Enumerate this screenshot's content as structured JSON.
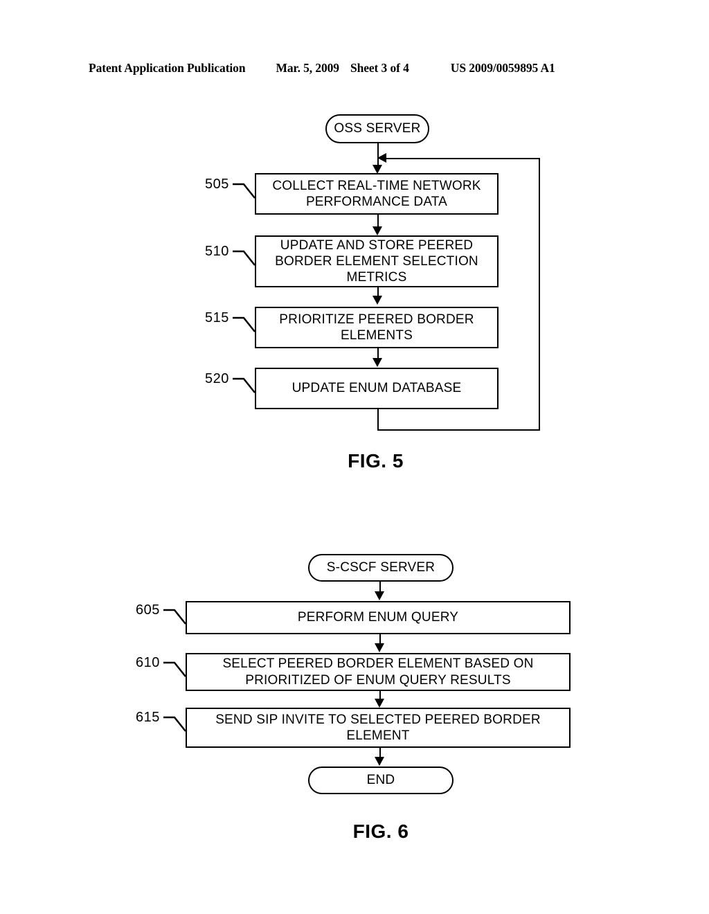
{
  "header": {
    "publication": "Patent Application Publication",
    "date": "Mar. 5, 2009",
    "sheet": "Sheet 3 of 4",
    "patent_number": "US 2009/0059895 A1"
  },
  "figures": [
    {
      "caption": "FIG. 5",
      "terminal_start": "OSS SERVER",
      "steps": [
        {
          "ref": "505",
          "label": "COLLECT REAL-TIME NETWORK PERFORMANCE DATA"
        },
        {
          "ref": "510",
          "label": "UPDATE AND STORE PEERED BORDER ELEMENT SELECTION METRICS"
        },
        {
          "ref": "515",
          "label": "PRIORITIZE PEERED BORDER ELEMENTS"
        },
        {
          "ref": "520",
          "label": "UPDATE ENUM DATABASE"
        }
      ],
      "has_feedback_loop": true
    },
    {
      "caption": "FIG. 6",
      "terminal_start": "S-CSCF SERVER",
      "steps": [
        {
          "ref": "605",
          "label": "PERFORM ENUM QUERY"
        },
        {
          "ref": "610",
          "label": "SELECT PEERED BORDER ELEMENT BASED ON PRIORITIZED OF ENUM QUERY RESULTS"
        },
        {
          "ref": "615",
          "label": "SEND SIP INVITE TO SELECTED PEERED BORDER ELEMENT"
        }
      ],
      "terminal_end": "END",
      "has_feedback_loop": false
    }
  ],
  "colors": {
    "ink": "#000000",
    "paper": "#ffffff"
  }
}
